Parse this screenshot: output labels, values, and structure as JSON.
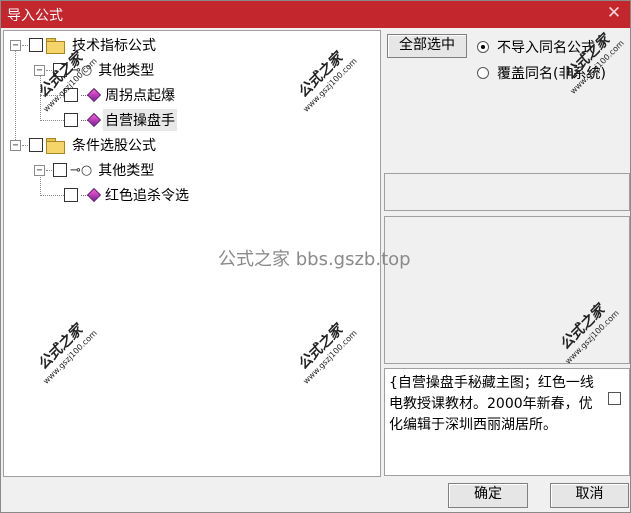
{
  "window": {
    "title": "导入公式",
    "close_glyph": "✕"
  },
  "tree": {
    "groups": [
      {
        "label": "技术指标公式",
        "child_label": "其他类型",
        "items": [
          "周拐点起爆",
          "自营操盘手"
        ]
      },
      {
        "label": "条件选股公式",
        "child_label": "其他类型",
        "items": [
          "红色追杀令选"
        ]
      }
    ],
    "selected": "自营操盘手"
  },
  "actions": {
    "select_all": "全部选中",
    "option_skip": "不导入同名公式",
    "option_overwrite": "覆盖同名(非系统)",
    "selected_option": "skip"
  },
  "description": "{自营操盘手秘藏主图；红色一线电教授课教材。2000年新春，优化编辑于深圳西丽湖居所。",
  "buttons": {
    "ok": "确定",
    "cancel": "取消"
  },
  "watermark": {
    "center": "公式之家 bbs.gszb.top",
    "stamp_title": "公式之家",
    "stamp_url": "www.gszj100.com"
  },
  "icons": {
    "expander_open": "−",
    "key": "⊸○"
  }
}
